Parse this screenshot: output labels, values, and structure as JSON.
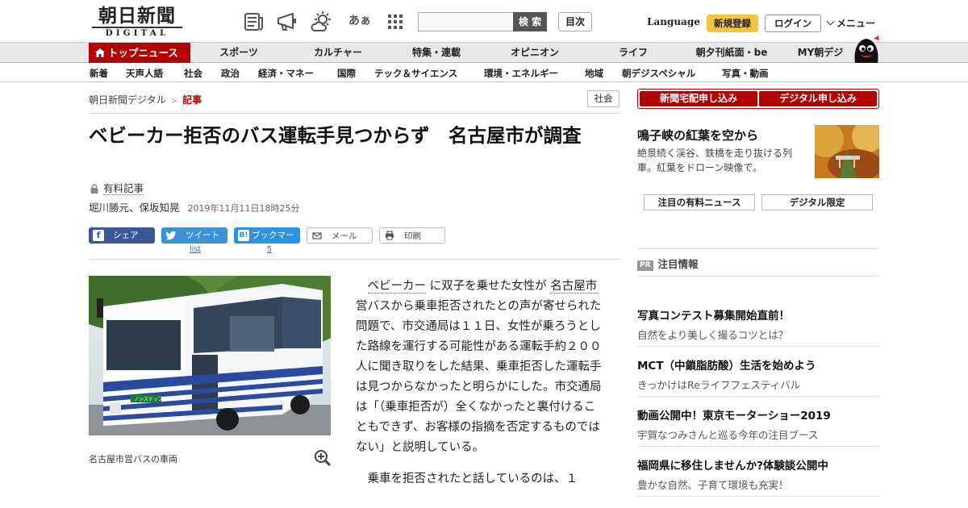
{
  "header": {
    "logo_jp": "朝日新聞",
    "logo_en": "DIGITAL",
    "search_placeholder": "",
    "search_button": "検 索",
    "toc_button": "目次",
    "language": "Language",
    "signup": "新規登録",
    "login": "ログイン",
    "menu": "メニュー",
    "icons": [
      "newspaper-icon",
      "megaphone-icon",
      "weather-icon",
      "font-size-icon",
      "apps-grid-icon"
    ],
    "font_size_glyph": "あぁ"
  },
  "nav_primary": {
    "top": "トップニュース",
    "items": [
      "スポーツ",
      "カルチャー",
      "特集・連載",
      "オピニオン",
      "ライフ",
      "朝夕刊紙面・be",
      "MY朝デジ"
    ]
  },
  "nav_secondary": {
    "items": [
      "新着",
      "天声人語",
      "社会",
      "政治",
      "経済・マネー",
      "国際",
      "テック＆サイエンス",
      "環境・エネルギー",
      "地域",
      "朝デジスペシャル",
      "写真・動画"
    ]
  },
  "breadcrumb": {
    "home": "朝日新聞デジタル",
    "sep": ">",
    "current": "記事"
  },
  "category": "社会",
  "article": {
    "title": "ベビーカー拒否のバス運転手見つからず　名古屋市が調査",
    "paid_label": "有料記事",
    "authors": "堀川勝元、保坂知晃",
    "date": "2019年11月11日18時25分",
    "share": {
      "facebook": "シェア",
      "twitter": "ツイート",
      "hatena": "ブックマーク",
      "mail": "メール",
      "print": "印刷",
      "twitter_count": "list",
      "hatena_count": "5"
    },
    "photo_caption": "名古屋市営バスの車両",
    "bus_sign": "ノンステップバス",
    "body_kw1": "ベビーカー",
    "body_p1a": "に双子を乗せた女性が",
    "body_kw2": "名古屋市",
    "body_p1b": "営バスから乗車拒否されたとの声が寄せられた問題で、市交通局は１１日、女性が乗ろうとした路線を運行する可能性がある運転手約２００人に聞き取りをした結果、乗車拒否した運転手は見つからなかったと明らかにした。市交通局は「（乗車拒否が）全くなかったと裏付けることもできず、お客様の指摘を否定するものではない」と説明している。",
    "body_p2": "乗車を拒否されたと話しているのは、１"
  },
  "sidebar": {
    "cta_home": "新聞宅配申し込み",
    "cta_digital": "デジタル申し込み",
    "promo_title": "鳴子峡の紅葉を空から",
    "promo_desc": "絶景続く渓谷、鉄橋を走り抜ける列車。紅葉をドローン映像で。",
    "box_paid": "注目の有料ニュース",
    "box_digital": "デジタル限定",
    "pr_badge": "PR",
    "pr_heading": "注目情報",
    "ads": [
      {
        "title": "写真コンテスト募集開始直前！",
        "desc": "自然をより美しく撮るコツとは？"
      },
      {
        "title": "MCT（中鎖脂肪酸）生活を始めよう",
        "desc": "きっかけはReライフフェスティバル"
      },
      {
        "title": "動画公開中！東京モーターショー2019",
        "desc": "宇賀なつみさんと巡る今年の注目ブース"
      },
      {
        "title": "福岡県に移住しませんか?体験談公開中",
        "desc": "豊かな自然、子育て環境も充実！"
      }
    ]
  },
  "colors": {
    "brand_red": "#b30000",
    "signup_yellow": "#f5c542",
    "facebook": "#3b5998",
    "twitter": "#3a94d4",
    "hatena": "#2c93dd"
  }
}
